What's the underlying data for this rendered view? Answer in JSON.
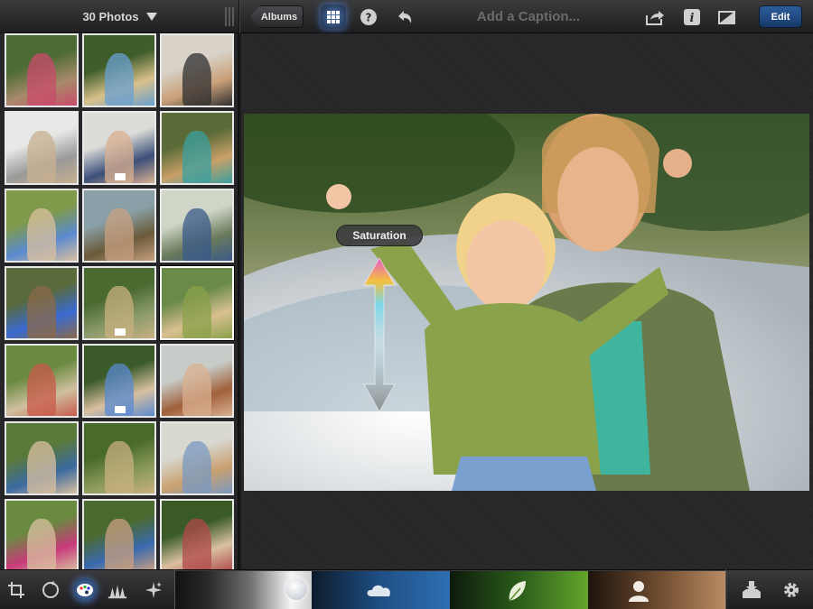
{
  "topbar": {
    "album_title": "30 Photos",
    "albums_label": "Albums",
    "caption_placeholder": "Add a Caption...",
    "edit_label": "Edit",
    "icons": [
      "grid-icon",
      "help-icon",
      "undo-icon",
      "share-icon",
      "info-icon",
      "flag-icon"
    ]
  },
  "viewer": {
    "overlay_label": "Saturation"
  },
  "sidebar": {
    "thumbnail_count": 21,
    "selected_index": 11
  },
  "bottombar": {
    "tools": [
      "crop-icon",
      "rotate-icon",
      "palette-icon",
      "brush-icon",
      "effects-icon"
    ],
    "strips": [
      "saturation-strip",
      "sky-strip",
      "foliage-strip",
      "skin-strip"
    ],
    "right_icons": [
      "import-icon",
      "settings-icon"
    ]
  },
  "colors": {
    "accent_blue": "#2e5d9c",
    "background": "#262628"
  }
}
